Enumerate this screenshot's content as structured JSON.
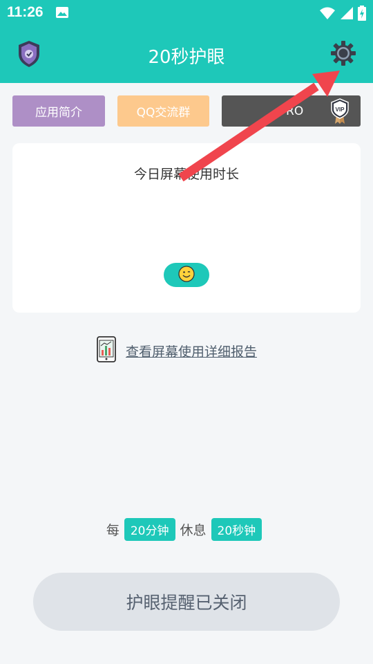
{
  "status": {
    "time": "11:26"
  },
  "app": {
    "title": "20秒护眼"
  },
  "buttons": {
    "intro": "应用简介",
    "qq": "QQ交流群",
    "pro": "PRO",
    "vip": "VIP"
  },
  "card": {
    "title": "今日屏幕使用时长"
  },
  "report": {
    "link": "查看屏幕使用详细报告"
  },
  "interval": {
    "every": "每",
    "work": "20分钟",
    "rest_label": "休息",
    "rest": "20秒钟"
  },
  "toggle": {
    "label": "护眼提醒已关闭"
  },
  "colors": {
    "primary": "#1ec8b9",
    "intro": "#ae8fc6",
    "qq": "#fdc98d",
    "pro": "#555555",
    "arrow": "#f0454d"
  },
  "icons": [
    "image-icon",
    "wifi-icon",
    "signal-icon",
    "battery-icon",
    "shield-icon",
    "gear-icon",
    "vip-badge-icon",
    "smile-icon",
    "report-icon",
    "arrow-annotation"
  ]
}
